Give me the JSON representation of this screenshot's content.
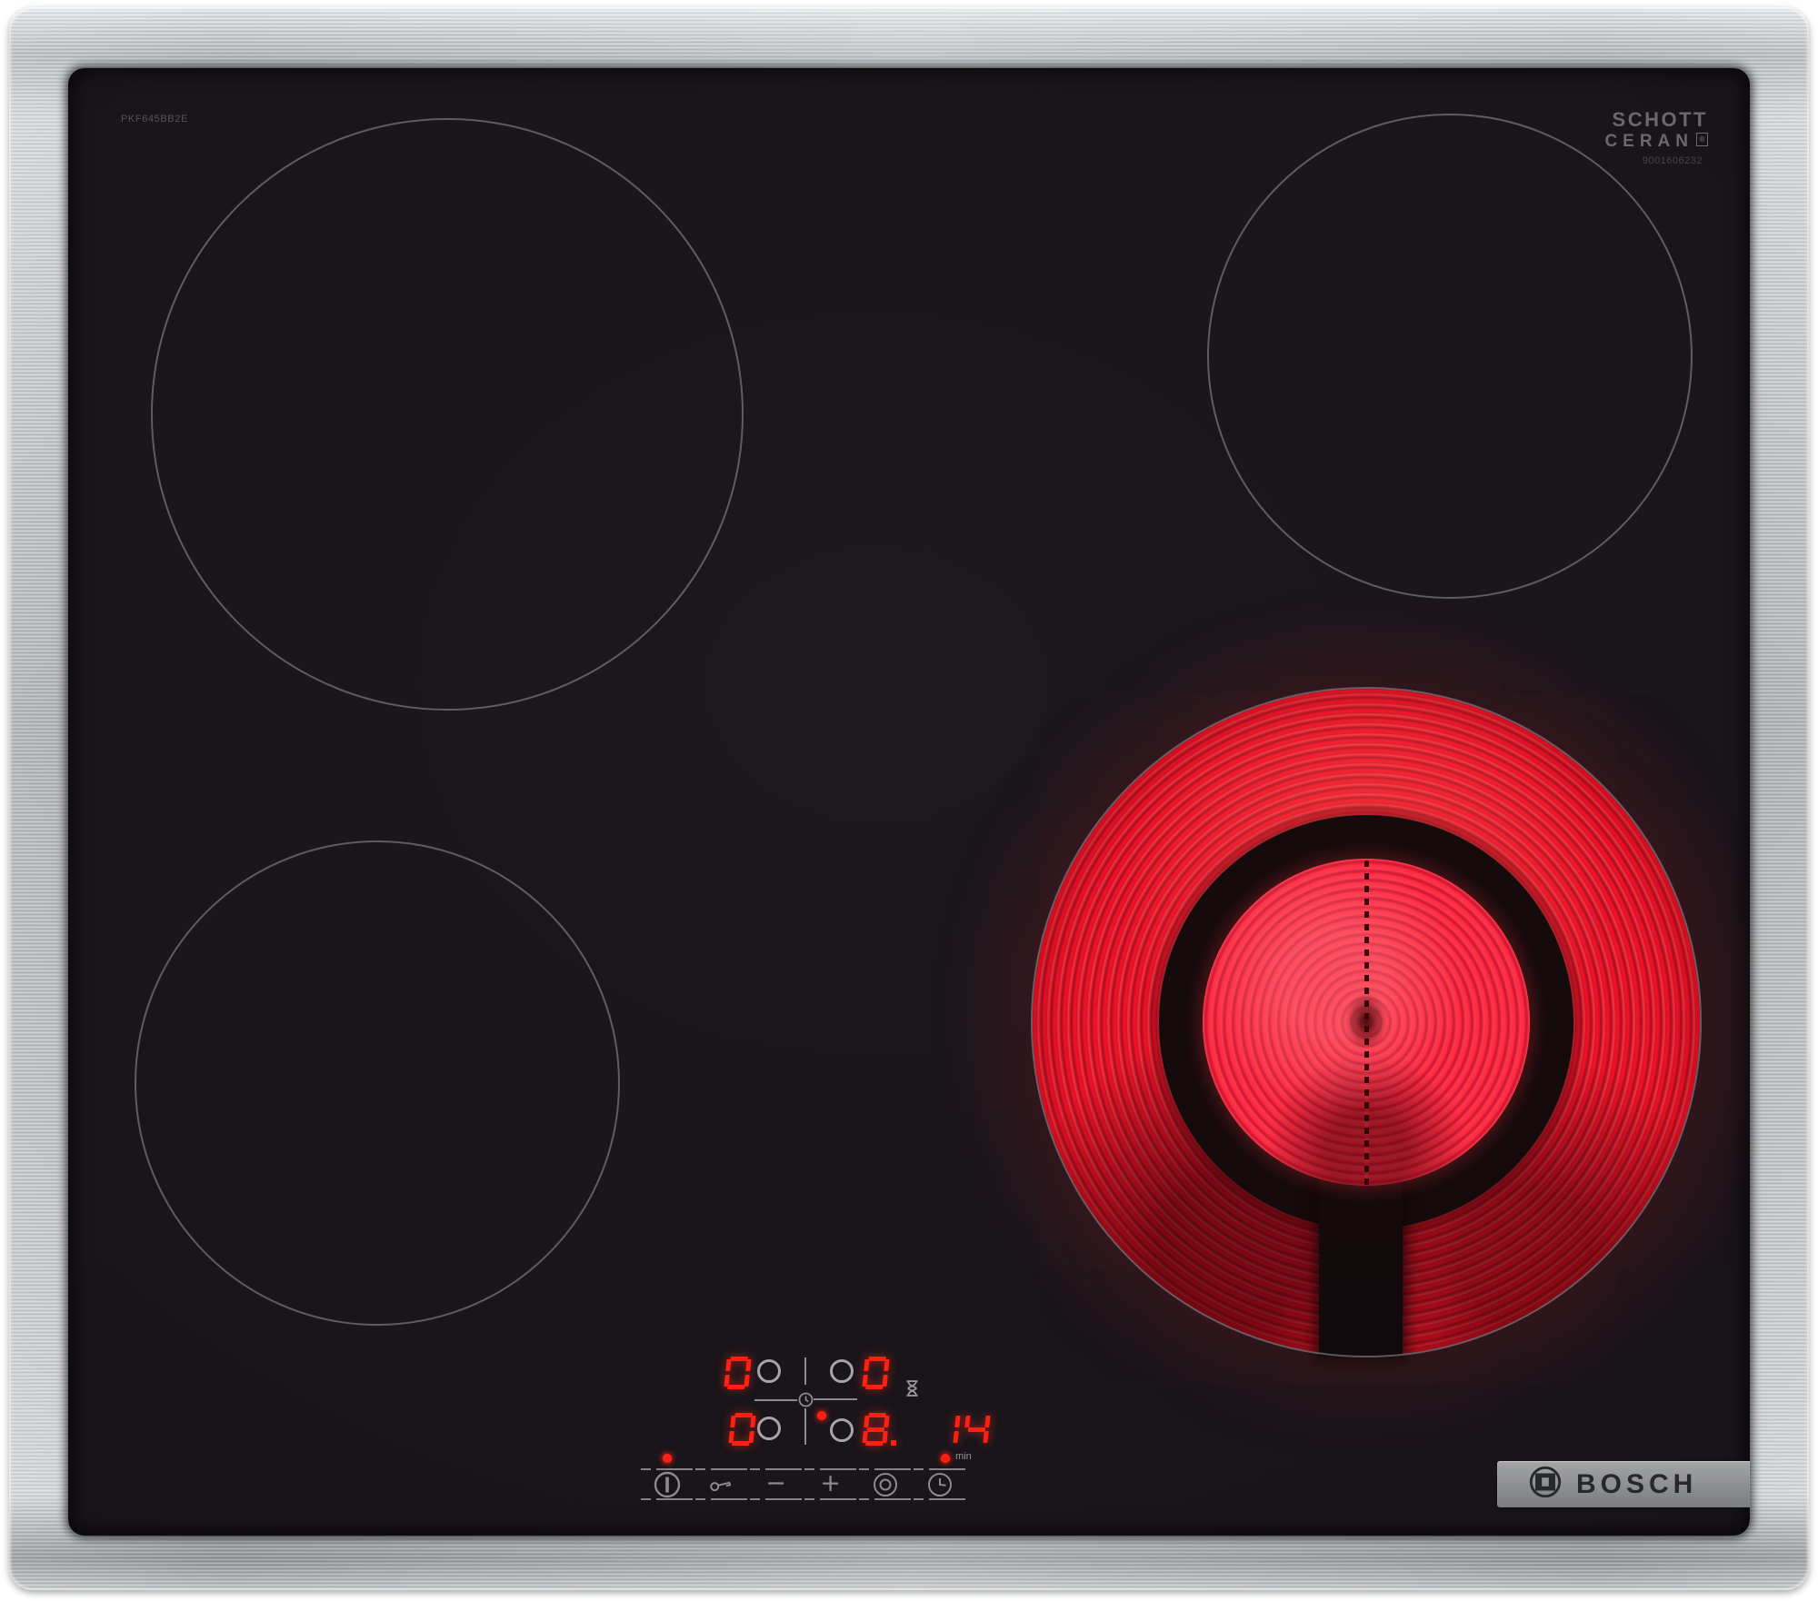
{
  "product": {
    "model_label": "PKF645BB2E",
    "glass_logo_line1": "SCHOTT",
    "glass_logo_line2": "CERAN",
    "glass_logo_reg": "®",
    "serial_number": "9001606232",
    "brand_logo_text": "BOSCH"
  },
  "display": {
    "zone_back_left": "0",
    "zone_back_right": "0",
    "zone_front_left": "0",
    "zone_front_right": "8.",
    "timer_value": "14",
    "timer_unit_label": "min",
    "icons": [
      "hourglass-icon",
      "timer-clock-icon"
    ],
    "indicators": {
      "power_indicator_on": true,
      "zone_select_indicator_on": true,
      "timer_min_indicator_on": true
    }
  },
  "controls": {
    "buttons": [
      {
        "name": "power",
        "icon": "power-icon"
      },
      {
        "name": "child-lock",
        "icon": "key-icon"
      },
      {
        "name": "decrease",
        "icon": "minus-icon",
        "glyph": "−"
      },
      {
        "name": "increase",
        "icon": "plus-icon",
        "glyph": "+"
      },
      {
        "name": "zone-select",
        "icon": "dual-ring-icon"
      },
      {
        "name": "timer",
        "icon": "clock-icon"
      }
    ]
  },
  "state": {
    "active_zone": "front-right-glowing-red"
  },
  "colors": {
    "led_red": "#ff2013",
    "panel_grey": "#8d8a8e",
    "glass_black": "#171318",
    "frame_silver": "#b6babd",
    "badge_grey": "#8d8e90",
    "burner_glow": "#ee1127"
  }
}
